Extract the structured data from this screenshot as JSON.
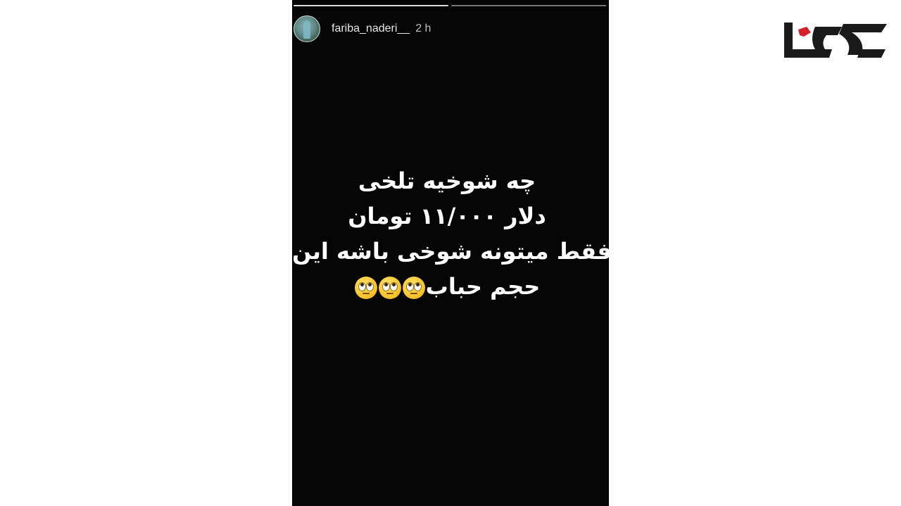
{
  "story": {
    "progress_segments": [
      {
        "state": "done"
      },
      {
        "state": "current"
      }
    ],
    "header": {
      "username": "fariba_naderi__",
      "time": "2 h",
      "avatar_icon": "profile-avatar"
    },
    "text_lines": [
      "چه شوخیه تلخی",
      "دلار ۱۱/۰۰۰ تومان",
      "فقط میتونه شوخی باشه این",
      "حجم حباب"
    ],
    "emoji": "face-with-rolling-eyes",
    "emoji_count": 3,
    "text_color": "#ffffff",
    "background_color": "#050505"
  },
  "logo": {
    "icon": "brand-logo",
    "primary_color": "#1a1a1a",
    "accent_color": "#d6202a"
  }
}
